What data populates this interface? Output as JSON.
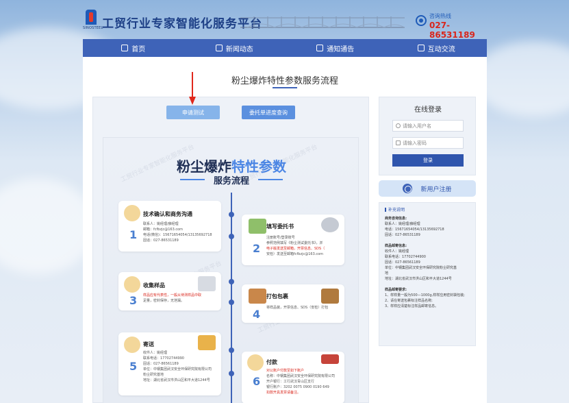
{
  "header": {
    "logo_sub": "SINOSTEEL",
    "site_title": "工贸行业专家智能化服务平台",
    "hotline_label": "咨询热线",
    "hotline_number": "027-86531189"
  },
  "nav": {
    "items": [
      {
        "label": "首页",
        "icon": "home-icon"
      },
      {
        "label": "新闻动态",
        "icon": "news-icon"
      },
      {
        "label": "通知通告",
        "icon": "notice-icon"
      },
      {
        "label": "互动交流",
        "icon": "chat-icon"
      }
    ]
  },
  "main": {
    "page_title": "粉尘爆炸特性参数服务流程",
    "apply_button": "申请测试",
    "query_button": "委托单进度查询"
  },
  "poster": {
    "title_a": "粉尘爆炸",
    "title_b": "特性参数",
    "subtitle": "服务流程",
    "watermark": "工贸行业专家智能化服务平台",
    "steps": [
      {
        "num": "1",
        "title": "技术确认和商务沟通",
        "lines": [
          "联系人：姚经理/薛经理",
          "邮箱：fcfbzjc@163.com",
          "电话(微信)：15671654054/13135692718",
          "固话：027-86531189"
        ]
      },
      {
        "num": "2",
        "title": "填写委托书",
        "lines": [
          "注册账号/登录账号",
          "参照范例填写《粉尘测试委托书》，并",
          "电子版发送至邮箱，开票信息、SDS（",
          "安检）发送至邮箱fcfbzjc@163.com"
        ]
      },
      {
        "num": "3",
        "title": "收集样品",
        "lines": [
          "样品应有代表性，一般从待测样品中取",
          "足量，密封保存，无泄漏。"
        ]
      },
      {
        "num": "4",
        "title": "打包包裹",
        "lines": [
          "将样品装，开票信息、SDS（安检）打包"
        ]
      },
      {
        "num": "5",
        "title": "寄送",
        "lines": [
          "收件人：姚经理",
          "联系电话：17702744990",
          "固话：027-86561189",
          "单位：中钢集团武汉安全环保研究院有限公司",
          "粉尘研究基地",
          "地址：湖北省武汉市洪山区和平大道1244号"
        ]
      },
      {
        "num": "6",
        "title": "付款",
        "lines": [
          "对公账户付款至如下账户",
          "名称：中钢集团武汉安全环保研究院有限公司",
          "开户银行：工行武汉青山区支行",
          "银行账户：3202 0075 0900 0190 649",
          "扣款开具发票请备注。"
        ]
      }
    ]
  },
  "login": {
    "title": "在线登录",
    "username_placeholder": "请输入用户名",
    "password_placeholder": "请输入密码",
    "login_button": "登录"
  },
  "register": {
    "label": "新用户注册"
  },
  "notes": {
    "title": "补充说明",
    "sections": [
      {
        "heading": "商务咨询信息:",
        "lines": [
          "联系人：姚经理/薛经理",
          "电话：15671654054/13135692718",
          "固话：027-86531189"
        ]
      },
      {
        "heading": "样品邮寄信息:",
        "lines": [
          "收件人：姚经理",
          "联系电话：17702744900",
          "固话：027-86561189",
          "单位：中钢集团武汉安全环保研究院粉尘研究基",
          "地",
          "地址：湖北省武汉市洪山区和平大道1244号"
        ]
      },
      {
        "heading": "样品邮寄要求:",
        "lines": [
          "1、样样量一般为500—1000g,样样应用密封袋包装;",
          "2、请在寄送包裹标注样品名称;",
          "3、样样应清楚标注样品邮寄信息。"
        ]
      }
    ]
  }
}
